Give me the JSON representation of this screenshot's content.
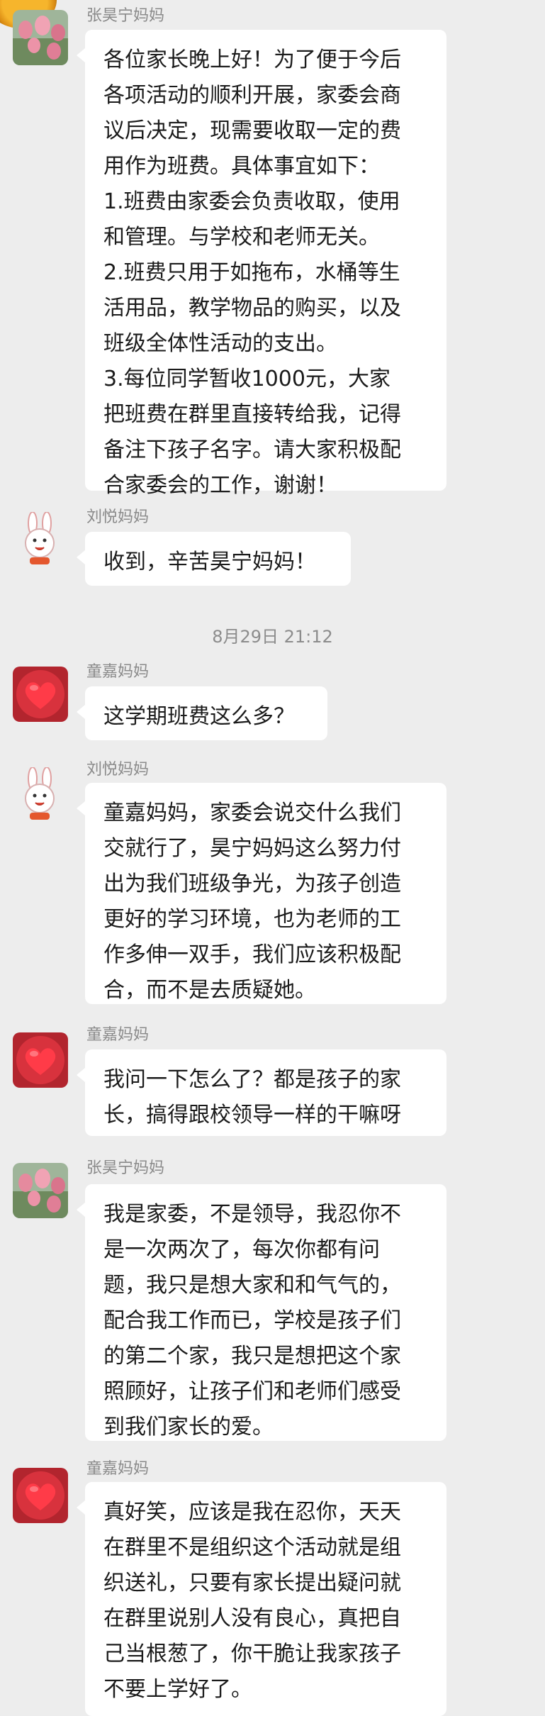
{
  "messages": [
    {
      "sender": "张昊宁妈妈",
      "avatar": "tulip-avatar",
      "lines": [
        "各位家长晚上好！为了便于今后",
        "各项活动的顺利开展，家委会商",
        "议后决定，现需要收取一定的费",
        "用作为班费。具体事宜如下：",
        "1.班费由家委会负责收取，使用",
        "和管理。与学校和老师无关。",
        "2.班费只用于如拖布，水桶等生",
        "活用品，教学物品的购买，以及",
        "班级全体性活动的支出。",
        "3.每位同学暂收1000元，大家",
        "把班费在群里直接转给我，记得",
        "备注下孩子名字。请大家积极配",
        "合家委会的工作，谢谢！"
      ]
    },
    {
      "sender": "刘悦妈妈",
      "avatar": "rabbit-avatar",
      "lines": [
        "收到，辛苦昊宁妈妈！"
      ]
    },
    {
      "sender": "童嘉妈妈",
      "avatar": "heart-avatar",
      "lines": [
        "这学期班费这么多？"
      ]
    },
    {
      "sender": "刘悦妈妈",
      "avatar": "rabbit-avatar",
      "lines": [
        "童嘉妈妈，家委会说交什么我们",
        "交就行了，昊宁妈妈这么努力付",
        "出为我们班级争光，为孩子创造",
        "更好的学习环境，也为老师的工",
        "作多伸一双手，我们应该积极配",
        "合，而不是去质疑她。"
      ]
    },
    {
      "sender": "童嘉妈妈",
      "avatar": "heart-avatar",
      "lines": [
        "我问一下怎么了？都是孩子的家",
        "长，搞得跟校领导一样的干嘛呀"
      ]
    },
    {
      "sender": "张昊宁妈妈",
      "avatar": "tulip-avatar",
      "lines": [
        "我是家委，不是领导，我忍你不",
        "是一次两次了，每次你都有问",
        "题，我只是想大家和和气气的，",
        "配合我工作而已，学校是孩子们",
        "的第二个家，我只是想把这个家",
        "照顾好，让孩子们和老师们感受",
        "到我们家长的爱。"
      ]
    },
    {
      "sender": "童嘉妈妈",
      "avatar": "heart-avatar",
      "lines": [
        "真好笑，应该是我在忍你，天天",
        "在群里不是组织这个活动就是组",
        "织送礼，只要有家长提出疑问就",
        "在群里说别人没有良心，真把自",
        "己当根葱了，你干脆让我家孩子",
        "不要上学好了。"
      ]
    }
  ],
  "timestamp": "8月29日 21:12",
  "colors": {
    "background": "#ededed",
    "bubble": "#ffffff",
    "name": "#8a8a8a"
  }
}
